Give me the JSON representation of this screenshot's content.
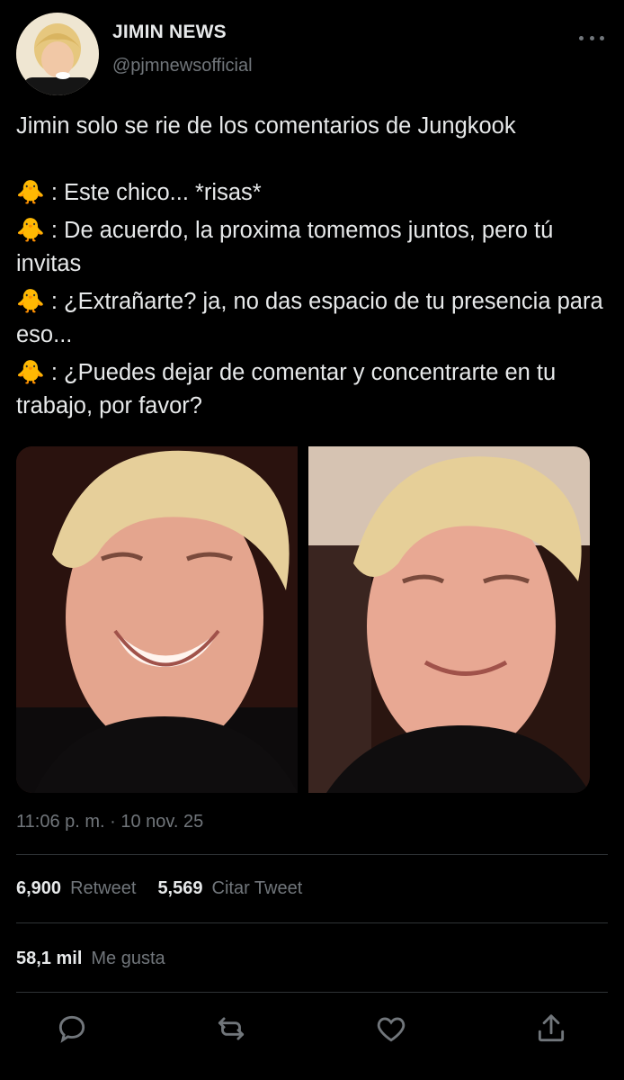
{
  "author": {
    "display_name": "JIMIN NEWS",
    "handle": "@pjmnewsofficial"
  },
  "tweet": {
    "lead": "Jimin solo se rie de los comentarios de Jungkook",
    "lines": [
      {
        "emoji": "🐥",
        "text": ": Este chico... *risas*"
      },
      {
        "emoji": "🐥",
        "text": ": De acuerdo, la proxima tomemos juntos, pero tú invitas"
      },
      {
        "emoji": "🐥",
        "text": ": ¿Extrañarte? ja, no das espacio de tu presencia para eso..."
      },
      {
        "emoji": "🐥",
        "text": ": ¿Puedes dejar de comentar y concentrarte en tu trabajo, por favor?"
      }
    ],
    "timestamp": "11:06 p. m. · 10 nov. 25"
  },
  "stats": {
    "retweets_count": "6,900",
    "retweets_label": "Retweet",
    "quotes_count": "5,569",
    "quotes_label": "Citar Tweet",
    "likes_count": "58,1 mil",
    "likes_label": "Me gusta"
  },
  "icons": {
    "more": "more-icon",
    "reply": "reply-icon",
    "retweet": "retweet-icon",
    "like": "heart-icon",
    "share": "share-icon"
  },
  "colors": {
    "background": "#000000",
    "text": "#e7e9ea",
    "secondary": "#71767b",
    "divider": "#2f3336"
  }
}
